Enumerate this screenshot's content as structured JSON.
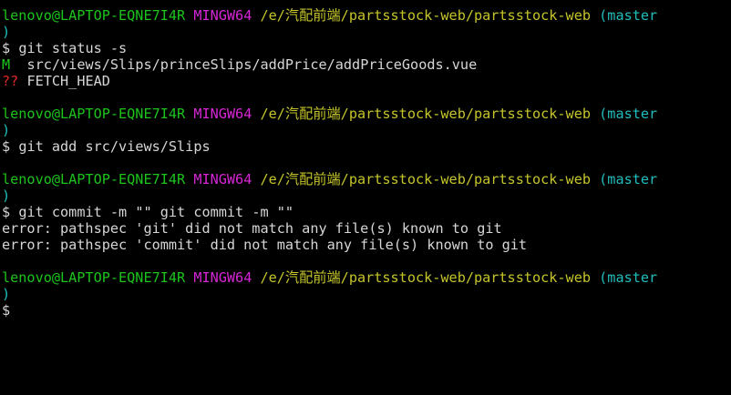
{
  "colors": {
    "background": "#000000",
    "user_host": "#1cc41c",
    "shell_name": "#d726d7",
    "path": "#c5c52a",
    "branch": "#22bdbd",
    "text": "#d6d6d6",
    "untracked": "#e02727"
  },
  "prompt": {
    "user_host": "lenovo@LAPTOP-EQNE7I4R",
    "shell": "MINGW64",
    "path": "/e/汽配前端/partsstock-web/partsstock-web",
    "branch_open": "(master",
    "branch_close": ")",
    "symbol": "$"
  },
  "blocks": [
    {
      "command": "git status -s",
      "output": [
        {
          "status": "M",
          "text": "src/views/Slips/princeSlips/addPrice/addPriceGoods.vue"
        },
        {
          "status": "??",
          "text": "FETCH_HEAD"
        }
      ]
    },
    {
      "command": "git add src/views/Slips",
      "output": []
    },
    {
      "command": "git commit -m \"\" git commit -m \"\"",
      "output": [
        {
          "text": "error: pathspec 'git' did not match any file(s) known to git"
        },
        {
          "text": "error: pathspec 'commit' did not match any file(s) known to git"
        }
      ]
    }
  ]
}
